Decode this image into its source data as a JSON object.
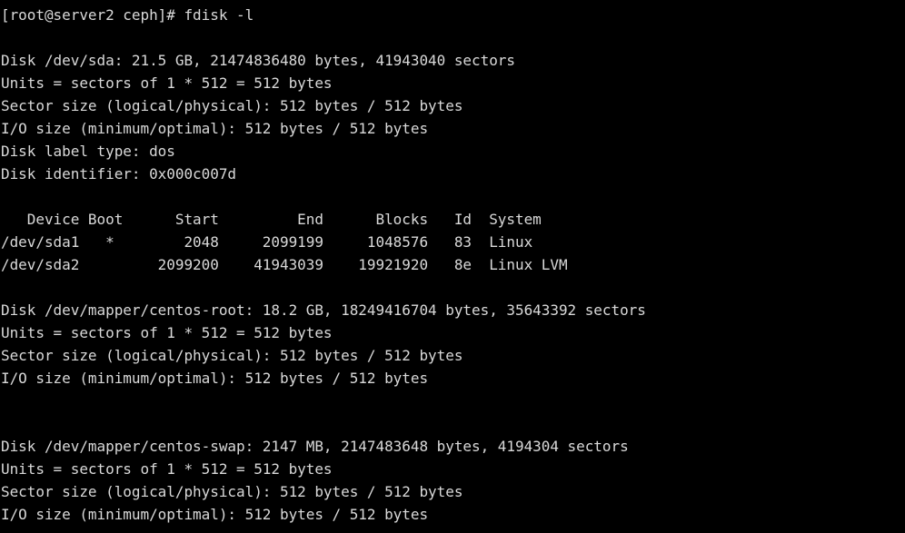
{
  "terminal": {
    "shell": "bash",
    "background_color": "#000000",
    "foreground_color": "#d9d9d9",
    "prompt": "[root@server2 ceph]#",
    "command": "fdisk -l",
    "prompt_line": "[root@server2 ceph]# fdisk -l",
    "lines": [
      "[root@server2 ceph]# fdisk -l",
      "",
      "Disk /dev/sda: 21.5 GB, 21474836480 bytes, 41943040 sectors",
      "Units = sectors of 1 * 512 = 512 bytes",
      "Sector size (logical/physical): 512 bytes / 512 bytes",
      "I/O size (minimum/optimal): 512 bytes / 512 bytes",
      "Disk label type: dos",
      "Disk identifier: 0x000c007d",
      "",
      "   Device Boot      Start         End      Blocks   Id  System",
      "/dev/sda1   *        2048     2099199     1048576   83  Linux",
      "/dev/sda2         2099200    41943039    19921920   8e  Linux LVM",
      "",
      "Disk /dev/mapper/centos-root: 18.2 GB, 18249416704 bytes, 35643392 sectors",
      "Units = sectors of 1 * 512 = 512 bytes",
      "Sector size (logical/physical): 512 bytes / 512 bytes",
      "I/O size (minimum/optimal): 512 bytes / 512 bytes",
      "",
      "",
      "Disk /dev/mapper/centos-swap: 2147 MB, 2147483648 bytes, 4194304 sectors",
      "Units = sectors of 1 * 512 = 512 bytes",
      "Sector size (logical/physical): 512 bytes / 512 bytes",
      "I/O size (minimum/optimal): 512 bytes / 512 bytes"
    ],
    "disks": [
      {
        "device": "/dev/sda",
        "size_human": "21.5 GB",
        "size_bytes": "21474836480 bytes",
        "sectors": "41943040 sectors",
        "units": "Units = sectors of 1 * 512 = 512 bytes",
        "sector_size": "Sector size (logical/physical): 512 bytes / 512 bytes",
        "io_size": "I/O size (minimum/optimal): 512 bytes / 512 bytes",
        "label_type": "Disk label type: dos",
        "identifier": "Disk identifier: 0x000c007d"
      },
      {
        "device": "/dev/mapper/centos-root",
        "size_human": "18.2 GB",
        "size_bytes": "18249416704 bytes",
        "sectors": "35643392 sectors",
        "units": "Units = sectors of 1 * 512 = 512 bytes",
        "sector_size": "Sector size (logical/physical): 512 bytes / 512 bytes",
        "io_size": "I/O size (minimum/optimal): 512 bytes / 512 bytes"
      },
      {
        "device": "/dev/mapper/centos-swap",
        "size_human": "2147 MB",
        "size_bytes": "2147483648 bytes",
        "sectors": "4194304 sectors",
        "units": "Units = sectors of 1 * 512 = 512 bytes",
        "sector_size": "Sector size (logical/physical): 512 bytes / 512 bytes",
        "io_size": "I/O size (minimum/optimal): 512 bytes / 512 bytes"
      }
    ],
    "partition_table": {
      "headers": [
        "Device",
        "Boot",
        "Start",
        "End",
        "Blocks",
        "Id",
        "System"
      ],
      "rows": [
        {
          "device": "/dev/sda1",
          "boot": "*",
          "start": "2048",
          "end": "2099199",
          "blocks": "1048576",
          "id": "83",
          "system": "Linux"
        },
        {
          "device": "/dev/sda2",
          "boot": "",
          "start": "2099200",
          "end": "41943039",
          "blocks": "19921920",
          "id": "8e",
          "system": "Linux LVM"
        }
      ]
    }
  }
}
